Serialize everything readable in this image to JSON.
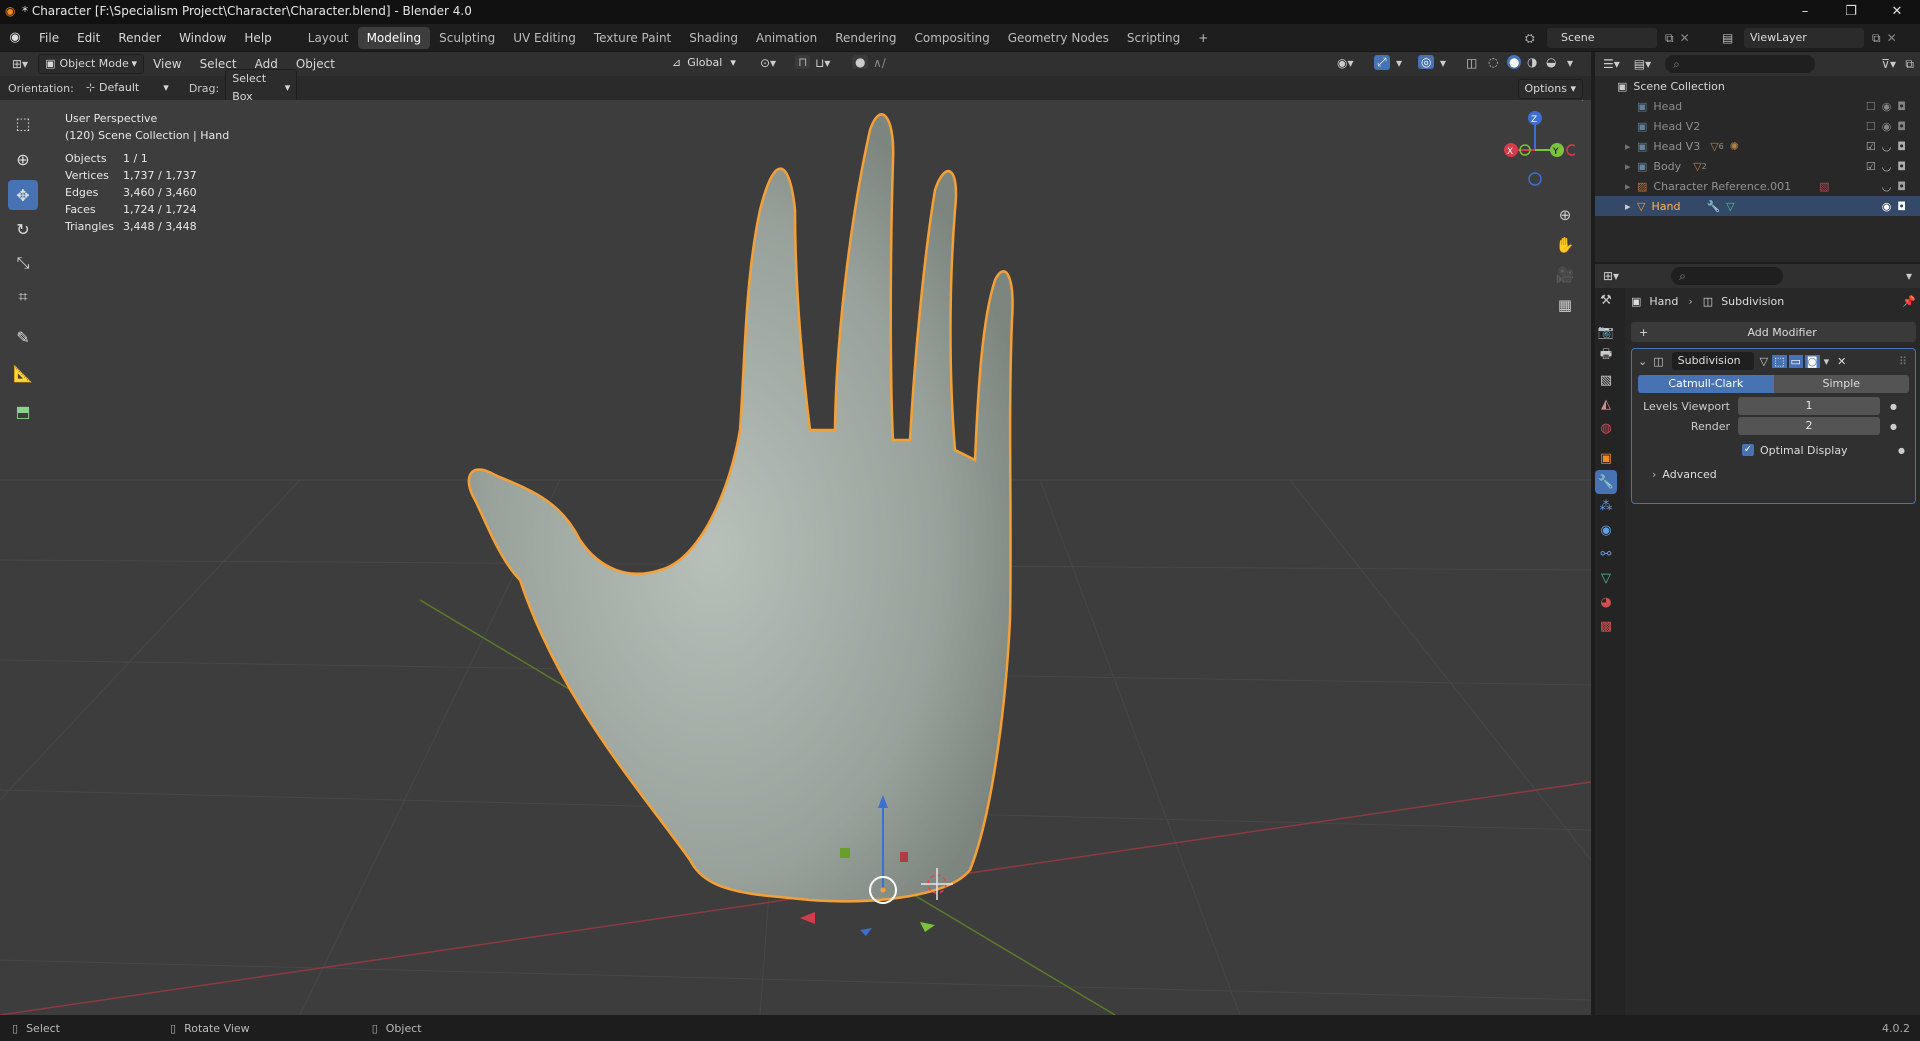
{
  "window": {
    "title": "* Character [F:\\Specialism Project\\Character\\Character.blend] - Blender 4.0",
    "minimize": "–",
    "maximize": "❐",
    "close": "✕"
  },
  "menus": [
    "File",
    "Edit",
    "Render",
    "Window",
    "Help"
  ],
  "workspaces": [
    "Layout",
    "Modeling",
    "Sculpting",
    "UV Editing",
    "Texture Paint",
    "Shading",
    "Animation",
    "Rendering",
    "Compositing",
    "Geometry Nodes",
    "Scripting"
  ],
  "workspace_add": "+",
  "scene": {
    "name": "Scene",
    "view_layer": "ViewLayer"
  },
  "viewport_header": {
    "mode": "Object Mode",
    "menus": [
      "View",
      "Select",
      "Add",
      "Object"
    ],
    "transform": "Global",
    "options": "Options"
  },
  "tool_settings": {
    "orientation_label": "Orientation:",
    "orientation_value": "Default",
    "drag_label": "Drag:",
    "drag_value": "Select Box"
  },
  "overlay": {
    "view": "User Perspective",
    "collection": "(120) Scene Collection | Hand",
    "stats": [
      {
        "label": "Objects",
        "value": "1 / 1"
      },
      {
        "label": "Vertices",
        "value": "1,737 / 1,737"
      },
      {
        "label": "Edges",
        "value": "3,460 / 3,460"
      },
      {
        "label": "Faces",
        "value": "1,724 / 1,724"
      },
      {
        "label": "Triangles",
        "value": "3,448 / 3,448"
      }
    ]
  },
  "gizmo": {
    "z": "Z",
    "y": "Y"
  },
  "outliner": {
    "root": "Scene Collection",
    "items": [
      {
        "name": "Head",
        "badge": ""
      },
      {
        "name": "Head V2",
        "badge": ""
      },
      {
        "name": "Head V3",
        "badge": "6"
      },
      {
        "name": "Body",
        "badge": "2"
      },
      {
        "name": "Character Reference.001",
        "badge": ""
      },
      {
        "name": "Hand",
        "badge": ""
      }
    ]
  },
  "properties": {
    "breadcrumb_object": "Hand",
    "breadcrumb_modifier": "Subdivision",
    "add_modifier": "Add Modifier",
    "modifier_name": "Subdivision",
    "type_catmull": "Catmull-Clark",
    "type_simple": "Simple",
    "levels_viewport_label": "Levels Viewport",
    "levels_viewport": "1",
    "render_label": "Render",
    "render_value": "2",
    "optimal_display": "Optimal Display",
    "advanced": "Advanced"
  },
  "statusbar": {
    "select": "Select",
    "rotate": "Rotate View",
    "object": "Object",
    "version": "4.0.2"
  },
  "colors": {
    "accent": "#4772b3",
    "selection_outline": "#f5a036",
    "x_axis": "#c8434f",
    "y_axis": "#6b9d2b",
    "z_axis": "#3b6fd1"
  }
}
